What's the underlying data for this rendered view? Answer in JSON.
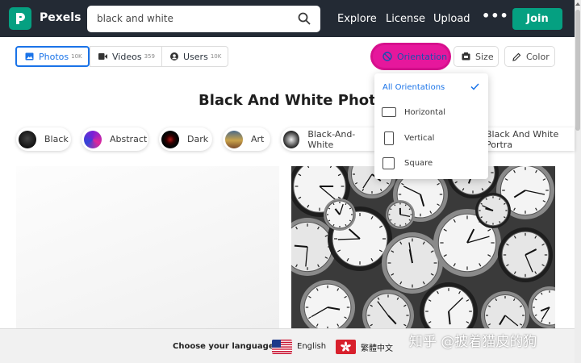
{
  "brand": {
    "name": "Pexels",
    "color": "#05a081"
  },
  "search": {
    "value": "black and white"
  },
  "nav": {
    "explore": "Explore",
    "license": "License",
    "upload": "Upload",
    "more": "•••",
    "join": "Join"
  },
  "tabs": [
    {
      "label": "Photos",
      "count": "10K",
      "icon": "image-icon"
    },
    {
      "label": "Videos",
      "count": "359",
      "icon": "video-icon"
    },
    {
      "label": "Users",
      "count": "10K",
      "icon": "user-icon"
    }
  ],
  "filters": {
    "orientation": "Orientation",
    "size": "Size",
    "color": "Color"
  },
  "page_title": "Black And White Photos",
  "chips": [
    "Black",
    "Abstract",
    "Dark",
    "Art",
    "Black-And-White",
    "Black And White Portra"
  ],
  "dropdown": {
    "items": [
      "All Orientations",
      "Horizontal",
      "Vertical",
      "Square"
    ],
    "selected": "All Orientations"
  },
  "language_bar": {
    "label": "Choose your language:",
    "english": "English",
    "chinese": "繁體中文"
  },
  "watermark": "知乎 @披着猫皮的狗",
  "colors": {
    "accent": "#1a73e8",
    "highlight": "#e6179c",
    "topbar": "#232a34"
  }
}
